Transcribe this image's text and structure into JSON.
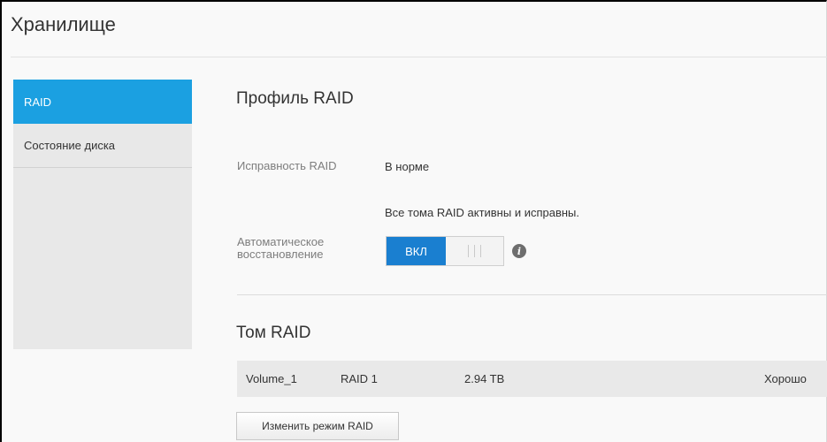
{
  "page": {
    "title": "Хранилище"
  },
  "sidebar": {
    "items": [
      {
        "label": "RAID",
        "active": true
      },
      {
        "label": "Состояние диска",
        "active": false
      }
    ]
  },
  "raid_profile": {
    "heading": "Профиль RAID",
    "health_label": "Исправность RAID",
    "health_value": "В норме",
    "health_detail": "Все тома RAID активны и исправны.",
    "auto_rebuild_label_line1": "Автоматическое",
    "auto_rebuild_label_line2": "восстановление",
    "auto_rebuild_toggle_label": "ВКЛ",
    "auto_rebuild_on": true,
    "info_icon": "info-icon"
  },
  "raid_volume": {
    "heading": "Том RAID",
    "rows": [
      {
        "name": "Volume_1",
        "level": "RAID 1",
        "size": "2.94 TB",
        "status": "Хорошо"
      }
    ],
    "change_button": "Изменить режим RAID"
  },
  "colors": {
    "accent": "#1ba0e1",
    "toggle_on": "#1a7fd0",
    "sidebar_bg": "#e8e8e8",
    "row_bg": "#e9e9e9"
  }
}
